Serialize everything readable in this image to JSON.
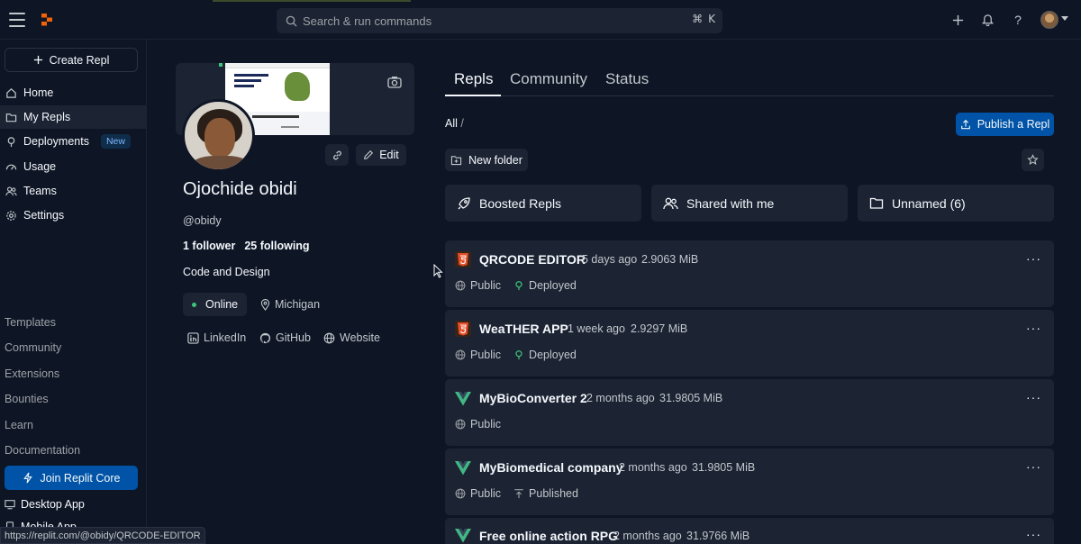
{
  "search": {
    "placeholder": "Search & run commands",
    "kbd_mod": "⌘",
    "kbd_key": "K"
  },
  "sidebar": {
    "create_label": "Create Repl",
    "items": [
      {
        "label": "Home",
        "icon": "home-icon"
      },
      {
        "label": "My Repls",
        "icon": "folder-icon",
        "active": true
      },
      {
        "label": "Deployments",
        "icon": "deployments-icon",
        "badge": "New"
      },
      {
        "label": "Usage",
        "icon": "gauge-icon"
      },
      {
        "label": "Teams",
        "icon": "teams-icon"
      },
      {
        "label": "Settings",
        "icon": "gear-icon"
      }
    ],
    "secondary": [
      "Templates",
      "Community",
      "Extensions",
      "Bounties",
      "Learn",
      "Documentation"
    ],
    "core_label": "Join Replit Core",
    "desktop_app": "Desktop App",
    "mobile_app": "Mobile App"
  },
  "status_url": "https://replit.com/@obidy/QRCODE-EDITOR",
  "profile": {
    "name": "Ojochide obidi",
    "handle": "@obidy",
    "followers": "1 follower",
    "following": "25 following",
    "bio": "Code and Design",
    "status": "Online",
    "location": "Michigan",
    "edit_label": "Edit",
    "links": [
      "LinkedIn",
      "GitHub",
      "Website"
    ]
  },
  "tabs": [
    "Repls",
    "Community",
    "Status"
  ],
  "breadcrumb": {
    "root": "All",
    "sep": "/"
  },
  "publish_label": "Publish a Repl",
  "new_folder_label": "New folder",
  "folders": [
    {
      "label": "Boosted Repls",
      "icon": "rocket-icon"
    },
    {
      "label": "Shared with me",
      "icon": "people-icon"
    },
    {
      "label": "Unnamed (6)",
      "icon": "folder-icon"
    }
  ],
  "repls": [
    {
      "title": "QRCODE EDITOR",
      "time": "5 days ago",
      "size": "2.9063 MiB",
      "lang": "html",
      "visibility": "Public",
      "status": "Deployed"
    },
    {
      "title": "WeaTHER APP",
      "time": "1 week ago",
      "size": "2.9297 MiB",
      "lang": "html",
      "visibility": "Public",
      "status": "Deployed"
    },
    {
      "title": "MyBioConverter 2",
      "time": "2 months ago",
      "size": "31.9805 MiB",
      "lang": "vue",
      "visibility": "Public",
      "status": ""
    },
    {
      "title": "MyBiomedical company",
      "time": "2 months ago",
      "size": "31.9805 MiB",
      "lang": "vue",
      "visibility": "Public",
      "status": "Published"
    },
    {
      "title": "Free online action RPG",
      "time": "2 months ago",
      "size": "31.9766 MiB",
      "lang": "vue",
      "visibility": "",
      "status": ""
    }
  ],
  "colors": {
    "bg": "#0e1525",
    "surface": "#1c2333",
    "accent": "#0053a6",
    "html_orange": "#e44d26",
    "vue_green": "#41b883",
    "deployed_green": "#3ec47a"
  }
}
